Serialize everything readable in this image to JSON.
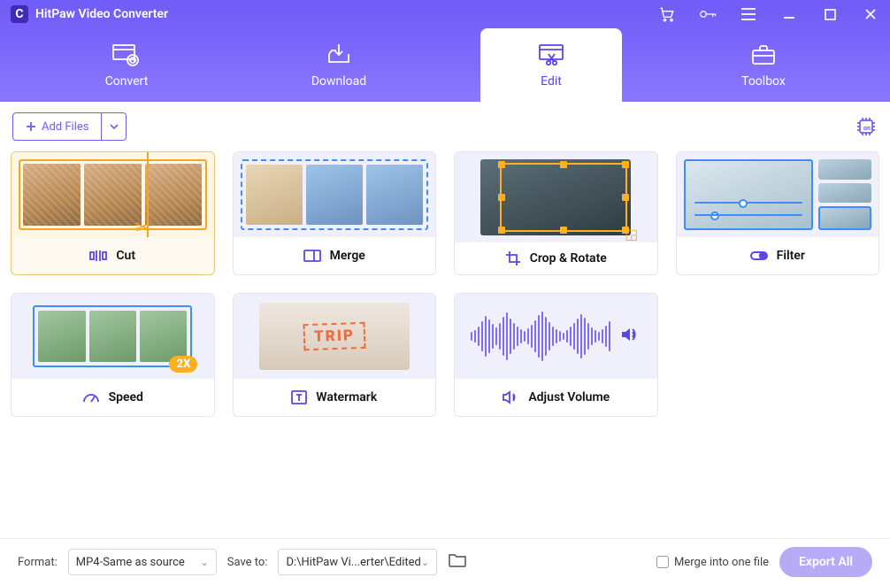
{
  "app": {
    "title": "HitPaw Video Converter"
  },
  "tabs": {
    "convert": "Convert",
    "download": "Download",
    "edit": "Edit",
    "toolbox": "Toolbox"
  },
  "toolbar": {
    "add_files": "Add Files"
  },
  "cards": {
    "cut": "Cut",
    "merge": "Merge",
    "crop": "Crop & Rotate",
    "filter": "Filter",
    "speed": "Speed",
    "speed_badge": "2X",
    "watermark": "Watermark",
    "wm_text": "TRIP",
    "volume": "Adjust Volume"
  },
  "bottom": {
    "format_label": "Format:",
    "format_value": "MP4-Same as source",
    "saveto_label": "Save to:",
    "saveto_value": "D:\\HitPaw Vi...erter\\Edited",
    "merge_one": "Merge into one file",
    "export": "Export All"
  }
}
